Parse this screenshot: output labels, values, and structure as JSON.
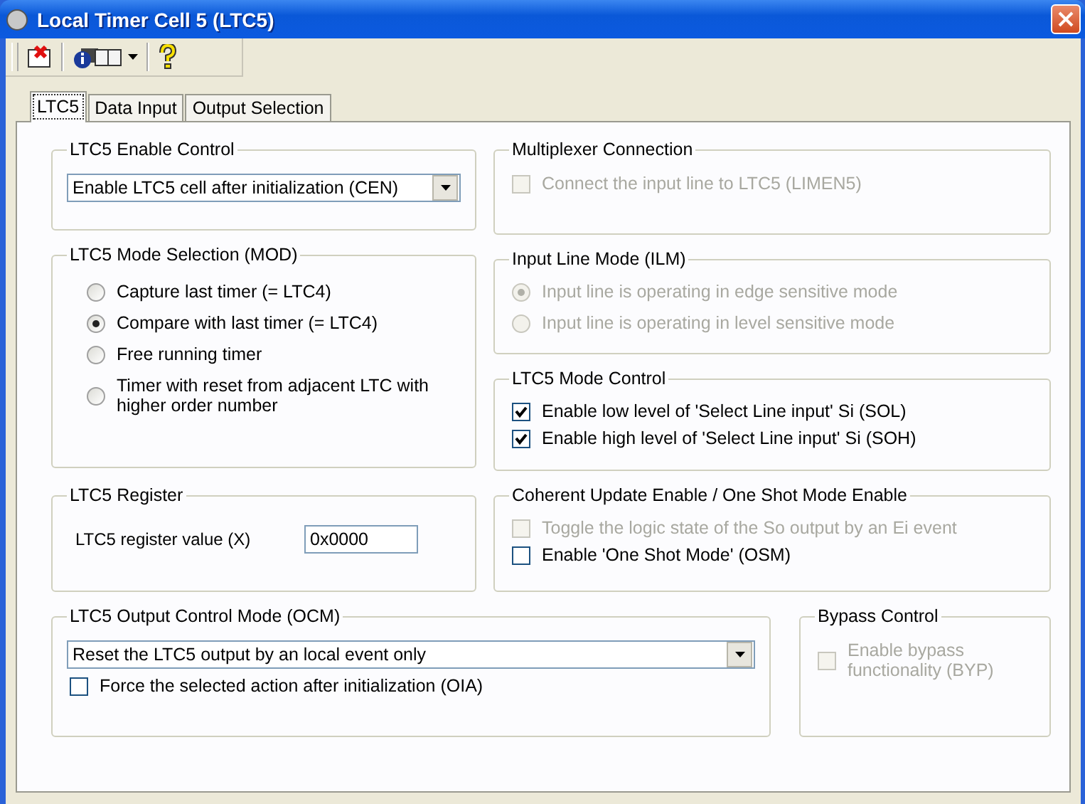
{
  "window": {
    "title": "Local Timer Cell 5 (LTC5)"
  },
  "tabs": [
    {
      "label": "LTC5",
      "selected": true
    },
    {
      "label": "Data Input",
      "selected": false
    },
    {
      "label": "Output Selection",
      "selected": false
    }
  ],
  "enable_control": {
    "title": "LTC5 Enable Control",
    "dropdown": {
      "value": "Enable LTC5 cell after initialization (CEN)"
    }
  },
  "mode_selection": {
    "title": "LTC5 Mode Selection (MOD)",
    "options": [
      {
        "label": "Capture last timer (= LTC4)",
        "selected": false,
        "disabled": false
      },
      {
        "label": "Compare with last timer (= LTC4)",
        "selected": true,
        "disabled": false
      },
      {
        "label": "Free running timer",
        "selected": false,
        "disabled": false
      },
      {
        "label": "Timer with reset from adjacent LTC with higher order number",
        "selected": false,
        "disabled": false
      }
    ]
  },
  "register": {
    "title": "LTC5 Register",
    "label": "LTC5 register value (X)",
    "value": "0x0000"
  },
  "multiplexer": {
    "title": "Multiplexer Connection",
    "checkboxes": [
      {
        "label": "Connect the input line to LTC5 (LIMEN5)",
        "checked": false,
        "disabled": true
      }
    ]
  },
  "input_line_mode": {
    "title": "Input Line Mode (ILM)",
    "options": [
      {
        "label": "Input line is operating in edge sensitive mode",
        "selected": true,
        "disabled": true
      },
      {
        "label": "Input line is operating in level sensitive mode",
        "selected": false,
        "disabled": true
      }
    ]
  },
  "mode_control": {
    "title": "LTC5 Mode Control",
    "checkboxes": [
      {
        "label": "Enable low level of 'Select Line input' Si (SOL)",
        "checked": true,
        "disabled": false
      },
      {
        "label": "Enable high level of 'Select Line input' Si (SOH)",
        "checked": true,
        "disabled": false
      }
    ]
  },
  "coherent_update": {
    "title": "Coherent Update Enable / One Shot Mode Enable",
    "checkboxes": [
      {
        "label": "Toggle the logic state of the So output by an Ei event",
        "checked": false,
        "disabled": true
      },
      {
        "label": "Enable 'One Shot Mode' (OSM)",
        "checked": false,
        "disabled": false
      }
    ]
  },
  "output_control_mode": {
    "title": "LTC5 Output Control Mode (OCM)",
    "dropdown": {
      "value": "Reset the LTC5 output by an local event only"
    },
    "checkboxes": [
      {
        "label": "Force the selected action after initialization (OIA)",
        "checked": false,
        "disabled": false
      }
    ]
  },
  "bypass": {
    "title": "Bypass Control",
    "checkboxes": [
      {
        "label": "Enable bypass functionality (BYP)",
        "checked": false,
        "disabled": true
      }
    ]
  }
}
